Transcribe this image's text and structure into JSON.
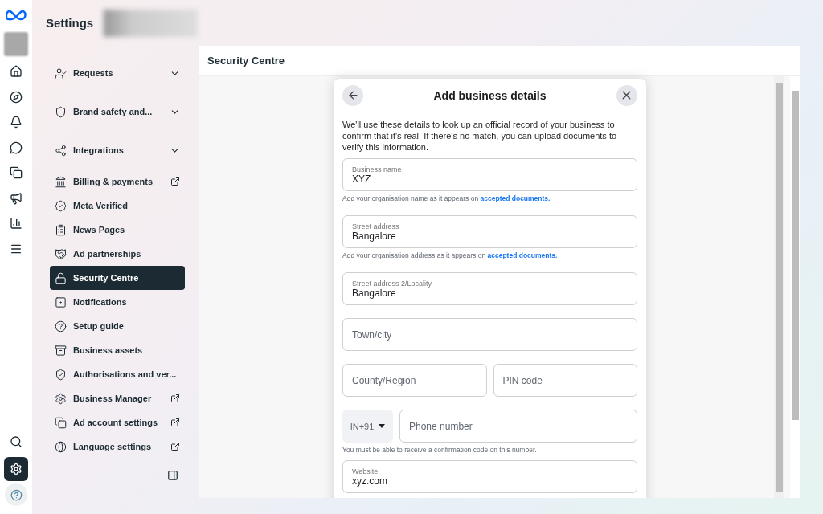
{
  "header": {
    "title": "Settings"
  },
  "rail": {
    "items": [
      {
        "selected": false
      },
      {
        "selected": false
      },
      {
        "selected": false
      },
      {
        "selected": false
      },
      {
        "selected": false
      },
      {
        "selected": false
      },
      {
        "selected": false
      },
      {
        "selected": false
      }
    ],
    "bottom": [
      {
        "selected": false
      },
      {
        "selected": true
      },
      {
        "selected": false
      }
    ]
  },
  "sidebar": {
    "items": [
      {
        "label": "Requests",
        "kind": "dropdown",
        "selected": false
      },
      {
        "label": "Brand safety and...",
        "kind": "dropdown",
        "selected": false
      },
      {
        "label": "Integrations",
        "kind": "dropdown",
        "selected": false
      },
      {
        "label": "Billing & payments",
        "kind": "external",
        "selected": false
      },
      {
        "label": "Meta Verified",
        "kind": "plain",
        "selected": false
      },
      {
        "label": "News Pages",
        "kind": "plain",
        "selected": false
      },
      {
        "label": "Ad partnerships",
        "kind": "plain",
        "selected": false
      },
      {
        "label": "Security Centre",
        "kind": "plain",
        "selected": true
      },
      {
        "label": "Notifications",
        "kind": "plain",
        "selected": false
      },
      {
        "label": "Setup guide",
        "kind": "plain",
        "selected": false
      },
      {
        "label": "Business assets",
        "kind": "plain",
        "selected": false
      },
      {
        "label": "Authorisations and ver...",
        "kind": "plain",
        "selected": false
      },
      {
        "label": "Business Manager",
        "kind": "external",
        "selected": false
      },
      {
        "label": "Ad account settings",
        "kind": "external",
        "selected": false
      },
      {
        "label": "Language settings",
        "kind": "external",
        "selected": false
      }
    ]
  },
  "main": {
    "title": "Security Centre"
  },
  "dialog": {
    "title": "Add business details",
    "intro": "We'll use these details to look up an official record of your business to confirm that it's real. If there's no match, you can upload documents to verify this information.",
    "fields": [
      {
        "kind": "filled",
        "label": "Business name",
        "value": "XYZ",
        "help": "Add your organisation name as it appears on ",
        "link": "accepted documents."
      },
      {
        "kind": "filled",
        "label": "Street address",
        "value": "Bangalore",
        "help": "Add your organisation address as it appears on ",
        "link": "accepted documents."
      },
      {
        "kind": "filled",
        "label": "Street address 2/Locality",
        "value": "Bangalore"
      },
      {
        "kind": "empty",
        "placeholder": "Town/city"
      },
      {
        "kind": "pair",
        "items": [
          {
            "placeholder": "County/Region"
          },
          {
            "placeholder": "PIN code"
          }
        ]
      },
      {
        "kind": "phone",
        "country": "IN+91",
        "placeholder": "Phone number",
        "help": "You must be able to receive a confirmation code on this number."
      },
      {
        "kind": "filled",
        "label": "Website",
        "value": "xyz.com"
      }
    ]
  }
}
